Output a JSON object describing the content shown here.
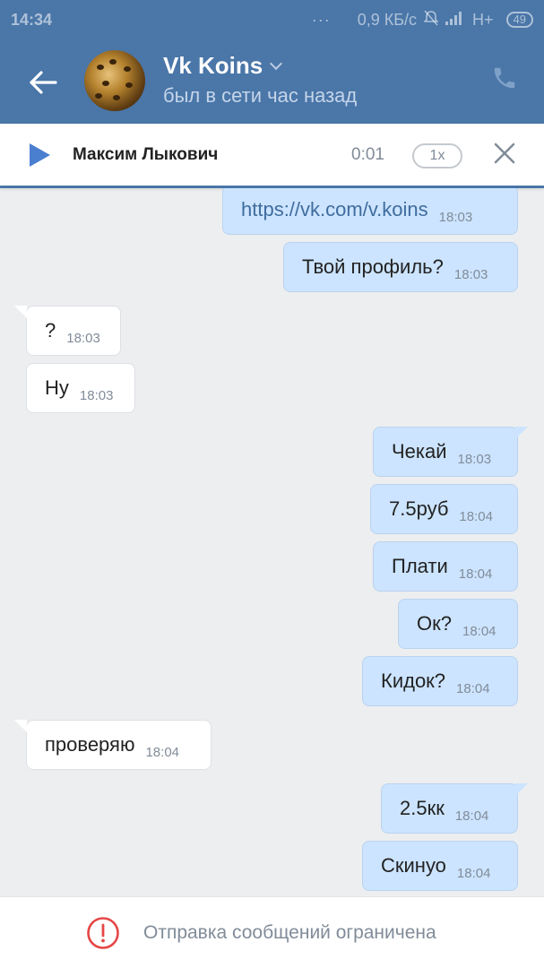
{
  "status_bar": {
    "time": "14:34",
    "dots": "···",
    "speed": "0,9 КБ/с",
    "network": "H+",
    "battery": "49"
  },
  "header": {
    "title": "Vk Koins",
    "subtitle": "был в сети час назад"
  },
  "player": {
    "name": "Максим Лыкович",
    "time": "0:01",
    "speed": "1x"
  },
  "messages": [
    {
      "dir": "out",
      "text": "https://vk.com/v.koins",
      "time": "18:03",
      "link": true
    },
    {
      "dir": "out",
      "text": "Твой профиль?",
      "time": "18:03"
    },
    {
      "dir": "in",
      "text": "?",
      "time": "18:03"
    },
    {
      "dir": "in",
      "text": "Ну",
      "time": "18:03"
    },
    {
      "dir": "out",
      "text": "Чекай",
      "time": "18:03"
    },
    {
      "dir": "out",
      "text": "7.5руб",
      "time": "18:04"
    },
    {
      "dir": "out",
      "text": "Плати",
      "time": "18:04"
    },
    {
      "dir": "out",
      "text": "Ок?",
      "time": "18:04"
    },
    {
      "dir": "out",
      "text": "Кидок?",
      "time": "18:04"
    },
    {
      "dir": "in",
      "text": "проверяю",
      "time": "18:04"
    },
    {
      "dir": "out",
      "text": "2.5кк",
      "time": "18:04"
    },
    {
      "dir": "out",
      "text": "Скинуо",
      "time": "18:04"
    }
  ],
  "notice": {
    "text": "Отправка сообщений ограничена"
  },
  "colors": {
    "header": "#4a76a8",
    "outgoing_bubble": "#cce4ff",
    "incoming_bubble": "#ffffff",
    "background": "#edeef0",
    "warning": "#e64646"
  },
  "icons": {
    "back": "arrow-left-icon",
    "call": "phone-icon",
    "play": "play-icon",
    "close": "close-icon",
    "notice": "exclamation-circle-icon"
  }
}
